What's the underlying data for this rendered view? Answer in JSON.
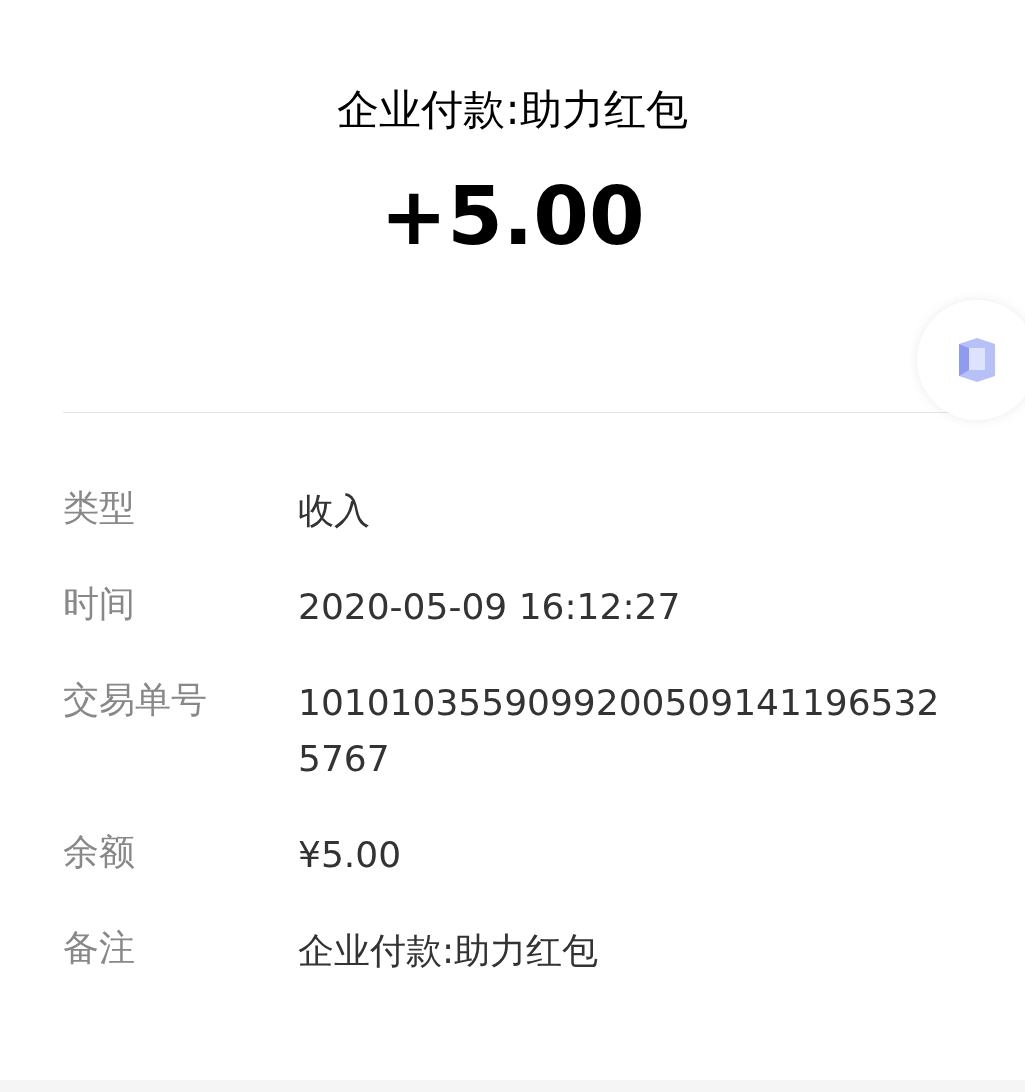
{
  "header": {
    "title": "企业付款:助力红包",
    "amount": "+5.00"
  },
  "details": [
    {
      "label": "类型",
      "value": "收入"
    },
    {
      "label": "时间",
      "value": "2020-05-09 16:12:27"
    },
    {
      "label": "交易单号",
      "value": "10101035590992005091411965325767"
    },
    {
      "label": "余额",
      "value": "¥5.00"
    },
    {
      "label": "备注",
      "value": "企业付款:助力红包"
    }
  ]
}
